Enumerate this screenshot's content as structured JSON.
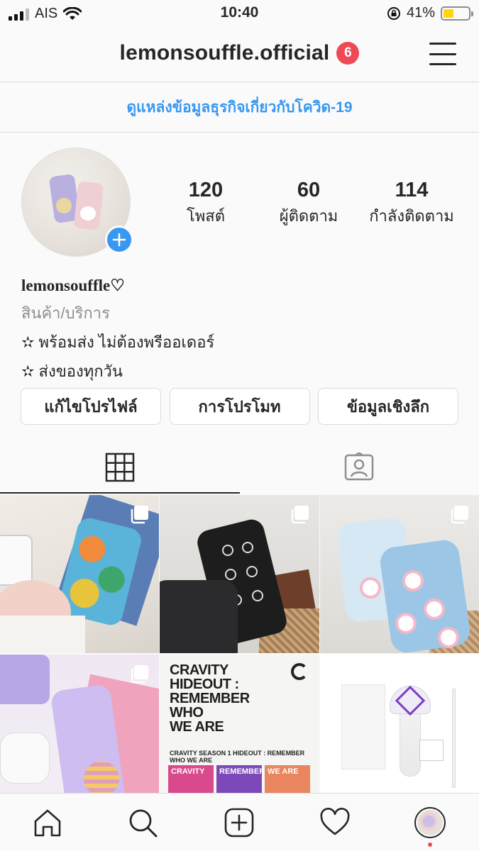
{
  "status_bar": {
    "carrier": "AIS",
    "time": "10:40",
    "battery_percent": "41%",
    "battery_level": 0.41,
    "icons": [
      "signal-icon",
      "wifi-icon",
      "orientation-lock-icon",
      "battery-icon"
    ]
  },
  "header": {
    "username": "lemonsouffle.official",
    "notification_count": "6",
    "menu_icon": "hamburger-menu-icon"
  },
  "covid_banner": {
    "link_text": "ดูแหล่งข้อมูลธุรกิจเกี่ยวกับโควิด-19",
    "color": "#3897f0"
  },
  "profile": {
    "stats": [
      {
        "value": "120",
        "label": "โพสต์"
      },
      {
        "value": "60",
        "label": "ผู้ติดตาม"
      },
      {
        "value": "114",
        "label": "กำลังติดตาม"
      }
    ],
    "display_name": "lemonsouffle♡",
    "category": "สินค้า/บริการ",
    "bio_lines": [
      "✫ พร้อมส่ง ไม่ต้องพรีออเดอร์",
      "✫ ส่งของทุกวัน"
    ]
  },
  "buttons": {
    "edit_profile": "แก้ไขโปรไฟล์",
    "promotions": "การโปรโมท",
    "insights": "ข้อมูลเชิงลึก"
  },
  "tabs": [
    {
      "icon": "grid-icon",
      "active": true
    },
    {
      "icon": "tagged-icon",
      "active": false
    }
  ],
  "posts": {
    "post5": {
      "title_lines": [
        "CRAVITY",
        "HIDEOUT :",
        "REMEMBER",
        "WHO",
        "WE ARE"
      ],
      "subtitle": "CRAVITY SEASON 1 HIDEOUT : REMEMBER WHO WE ARE",
      "album_text": [
        "CRAVITY",
        "HIDEOUT :",
        "REMEMBER",
        "WHO",
        "WE ARE"
      ]
    }
  },
  "bottom_nav": {
    "items": [
      "home-icon",
      "search-icon",
      "new-post-icon",
      "activity-heart-icon",
      "profile-avatar"
    ]
  },
  "colors": {
    "accent": "#3897f0",
    "badge": "#ed4956",
    "border": "#dbdbdb",
    "text": "#262626",
    "muted": "#8e8e8e"
  }
}
